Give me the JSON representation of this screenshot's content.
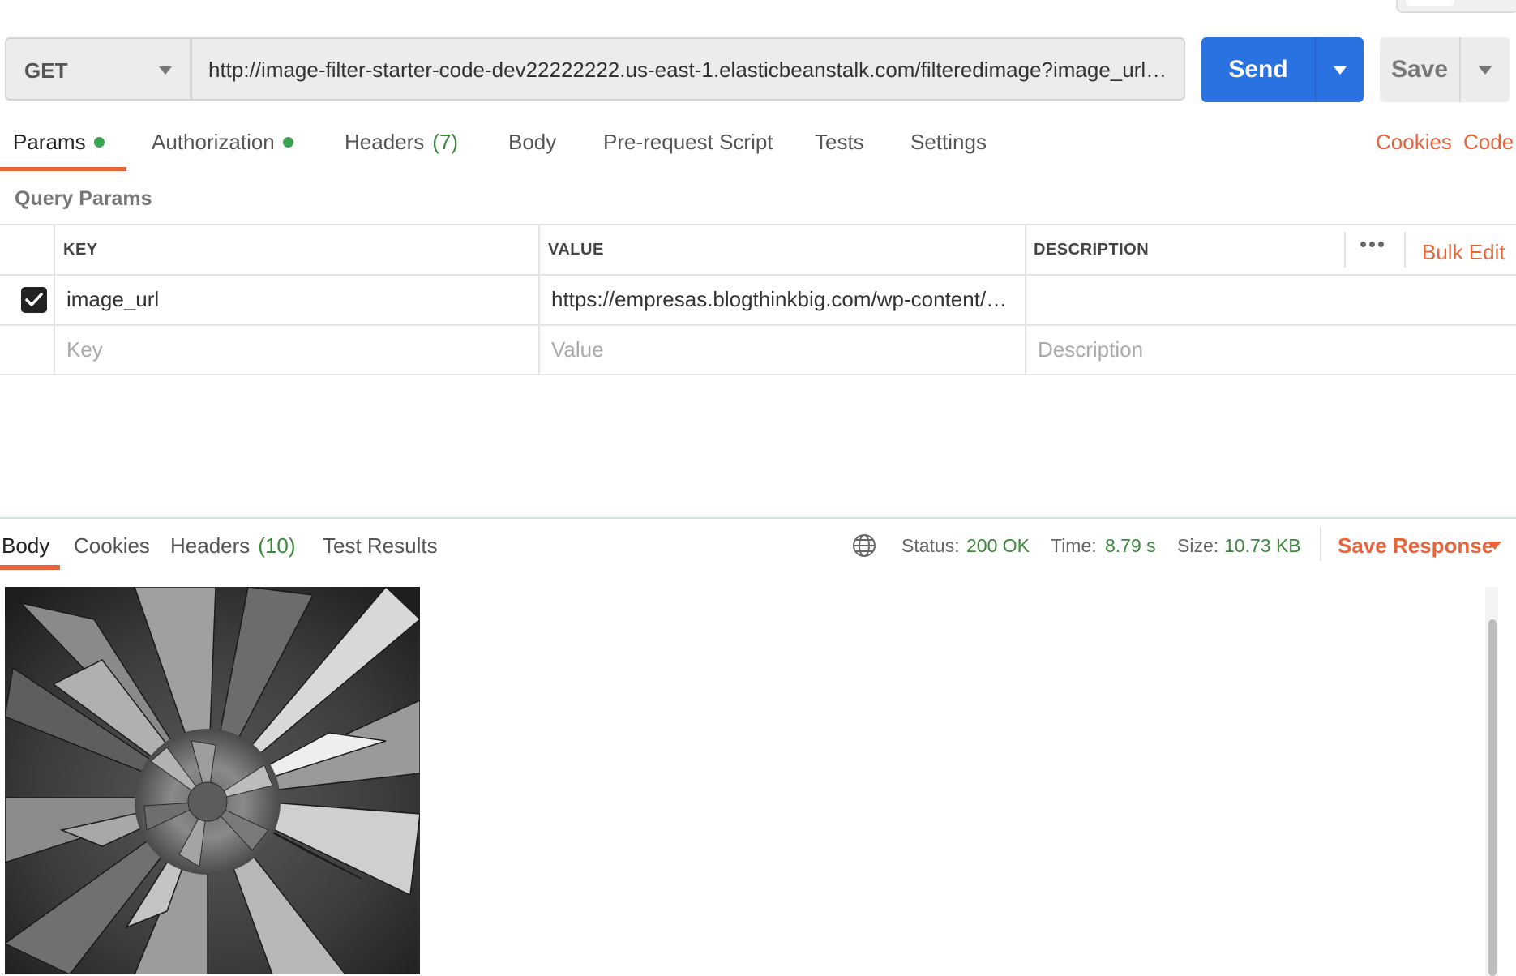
{
  "request": {
    "method": "GET",
    "url": "http://image-filter-starter-code-dev22222222.us-east-1.elasticbeanstalk.com/filteredimage?image_url=https://empresas.blogthinkbig.com/wp-content/u…",
    "send_label": "Send",
    "save_label": "Save"
  },
  "request_tabs": [
    {
      "label": "Params",
      "dot": true,
      "active": true
    },
    {
      "label": "Authorization",
      "dot": true
    },
    {
      "label": "Headers",
      "count": "(7)"
    },
    {
      "label": "Body"
    },
    {
      "label": "Pre-request Script"
    },
    {
      "label": "Tests"
    },
    {
      "label": "Settings"
    }
  ],
  "links": {
    "cookies": "Cookies",
    "code": "Code"
  },
  "params": {
    "section_label": "Query Params",
    "columns": {
      "key": "KEY",
      "value": "VALUE",
      "description": "DESCRIPTION"
    },
    "more_icon": "more-horizontal-icon",
    "bulk_edit": "Bulk Edit",
    "rows": [
      {
        "checked": true,
        "key": "image_url",
        "value": "https://empresas.blogthinkbig.com/wp-content/u…",
        "description": ""
      }
    ],
    "placeholders": {
      "key": "Key",
      "value": "Value",
      "description": "Description"
    }
  },
  "response": {
    "tabs": [
      {
        "label": "Body",
        "active": true
      },
      {
        "label": "Cookies"
      },
      {
        "label": "Headers",
        "count": "(10)"
      },
      {
        "label": "Test Results"
      }
    ],
    "globe_icon": "globe-icon",
    "status_label": "Status:",
    "status_value": "200 OK",
    "time_label": "Time:",
    "time_value": "8.79 s",
    "size_label": "Size:",
    "size_value": "10.73 KB",
    "save_response": "Save Response"
  },
  "colors": {
    "accent_orange": "#e8643a",
    "send_blue": "#2a72e2",
    "status_green": "#3a8a3a",
    "dot_green": "#3aa351"
  }
}
